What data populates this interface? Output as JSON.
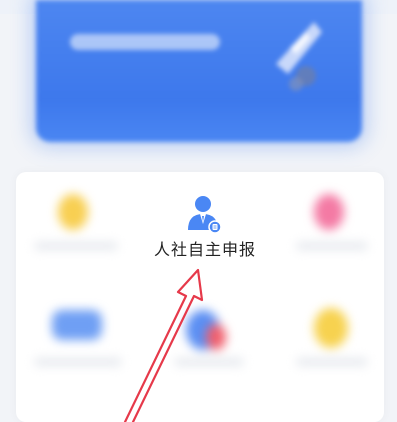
{
  "grid": {
    "highlighted_item": {
      "label": "人社自主申报",
      "icon": "person-in-suit-icon",
      "accent_color": "#4a87f4"
    },
    "blurred_items": [
      {
        "icon": "yellow-blurred-icon",
        "color": "#f8cf52"
      },
      {
        "icon": "pink-blurred-icon",
        "color": "#f47aa4"
      },
      {
        "icon": "blue-card-blurred-icon",
        "color": "#6f9ff4"
      },
      {
        "icon": "blue-red-blurred-icon",
        "color": "#5b8ff3"
      },
      {
        "icon": "yellow-blurred-icon",
        "color": "#f7d24f"
      }
    ]
  },
  "banner": {
    "color": "#4a86f2"
  },
  "annotation": {
    "arrow_color": "#e6394a"
  }
}
